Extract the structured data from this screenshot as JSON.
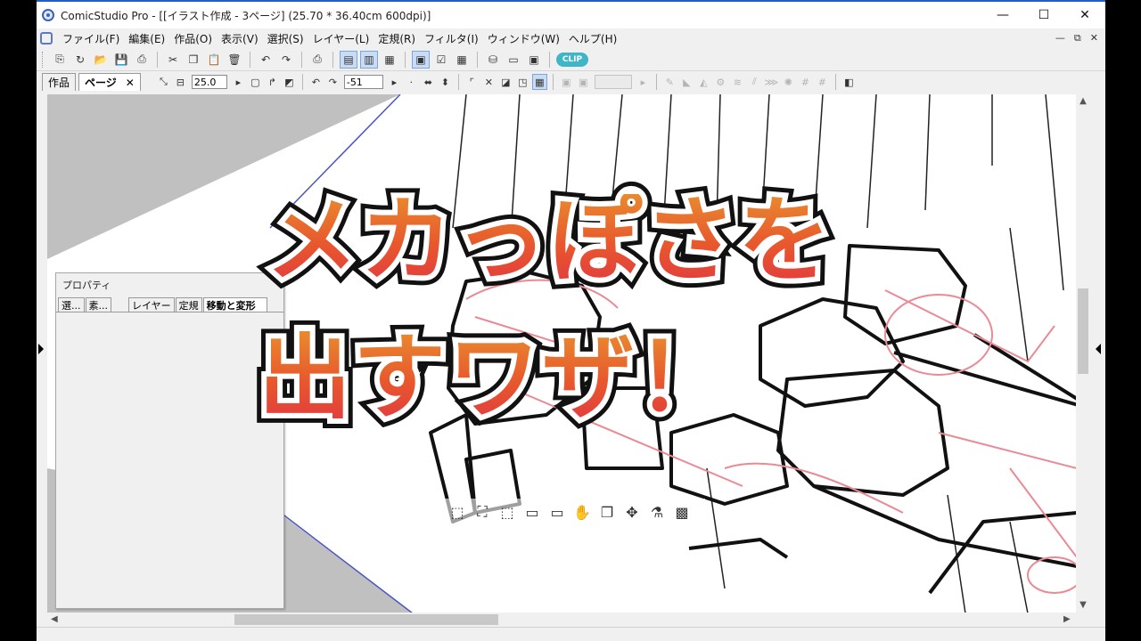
{
  "window": {
    "title": "ComicStudio Pro - [[イラスト作成 - 3ページ] (25.70 * 36.40cm 600dpi)]",
    "controls": {
      "minimize": "—",
      "maximize": "☐",
      "close": "✕"
    }
  },
  "menubar": {
    "items": [
      "ファイル(F)",
      "編集(E)",
      "作品(O)",
      "表示(V)",
      "選択(S)",
      "レイヤー(L)",
      "定規(R)",
      "フィルタ(I)",
      "ウィンドウ(W)",
      "ヘルプ(H)"
    ],
    "mdi_controls": [
      "—",
      "⧉",
      "✕"
    ]
  },
  "toolbar": {
    "buttons": [
      {
        "icon": "new-doc-icon",
        "glyph": "⎘"
      },
      {
        "icon": "new-page-icon",
        "glyph": "↻"
      },
      {
        "icon": "open-icon",
        "glyph": "📂"
      },
      {
        "icon": "save-icon",
        "glyph": "💾"
      },
      {
        "icon": "save-all-icon",
        "glyph": "⎙"
      },
      {
        "icon": "cut-icon",
        "glyph": "✂"
      },
      {
        "icon": "copy-icon",
        "glyph": "❐"
      },
      {
        "icon": "paste-icon",
        "glyph": "📋"
      },
      {
        "icon": "delete-icon",
        "glyph": "🗑"
      },
      {
        "icon": "undo-icon",
        "glyph": "↶"
      },
      {
        "icon": "redo-icon",
        "glyph": "↷"
      },
      {
        "icon": "print-icon",
        "glyph": "⎙"
      },
      {
        "icon": "view-page-icon",
        "glyph": "▤"
      },
      {
        "icon": "view-spread-icon",
        "glyph": "▥"
      },
      {
        "icon": "view-grid-icon",
        "glyph": "▦"
      },
      {
        "icon": "layout-icon",
        "glyph": "▣"
      },
      {
        "icon": "check-icon",
        "glyph": "☑"
      },
      {
        "icon": "color-grid-icon",
        "glyph": "▦"
      },
      {
        "icon": "material-icon",
        "glyph": "⛁"
      },
      {
        "icon": "window-icon",
        "glyph": "▭"
      },
      {
        "icon": "window2-icon",
        "glyph": "▣"
      }
    ],
    "clip_label": "CLIP"
  },
  "toolbar2": {
    "tabs": [
      {
        "label": "作品",
        "active": false
      },
      {
        "label": "ページ",
        "active": true
      }
    ],
    "tab_close": "✕",
    "zoom_value": "25.0",
    "rotate_value": "-51"
  },
  "properties_panel": {
    "title": "プロパティ",
    "tabs": [
      "選...",
      "素...",
      "レイヤー",
      "定規",
      "移動と変形"
    ],
    "active_tab": "移動と変形"
  },
  "overlay": {
    "line1": "メカっぽさを",
    "line2": "出すワザ！"
  },
  "floating_toolbar": {
    "icons": [
      "lasso-select-icon",
      "transform-icon",
      "expand-icon",
      "rect-select-icon",
      "rect-select2-icon",
      "fill-icon",
      "copy-paste-icon",
      "move-icon",
      "bucket-icon",
      "tone-icon"
    ],
    "glyphs": [
      "⬚",
      "⛶",
      "⬚",
      "▭",
      "▭",
      "✋",
      "❐",
      "✥",
      "⚗",
      "▩"
    ]
  },
  "colors": {
    "canvas_bg": "#ffffff",
    "gray_area": "#c0c0c0",
    "sketch_red": "#e98a94",
    "overlay_orange": "#e8572d",
    "accent_blue": "#1f5fc4"
  }
}
